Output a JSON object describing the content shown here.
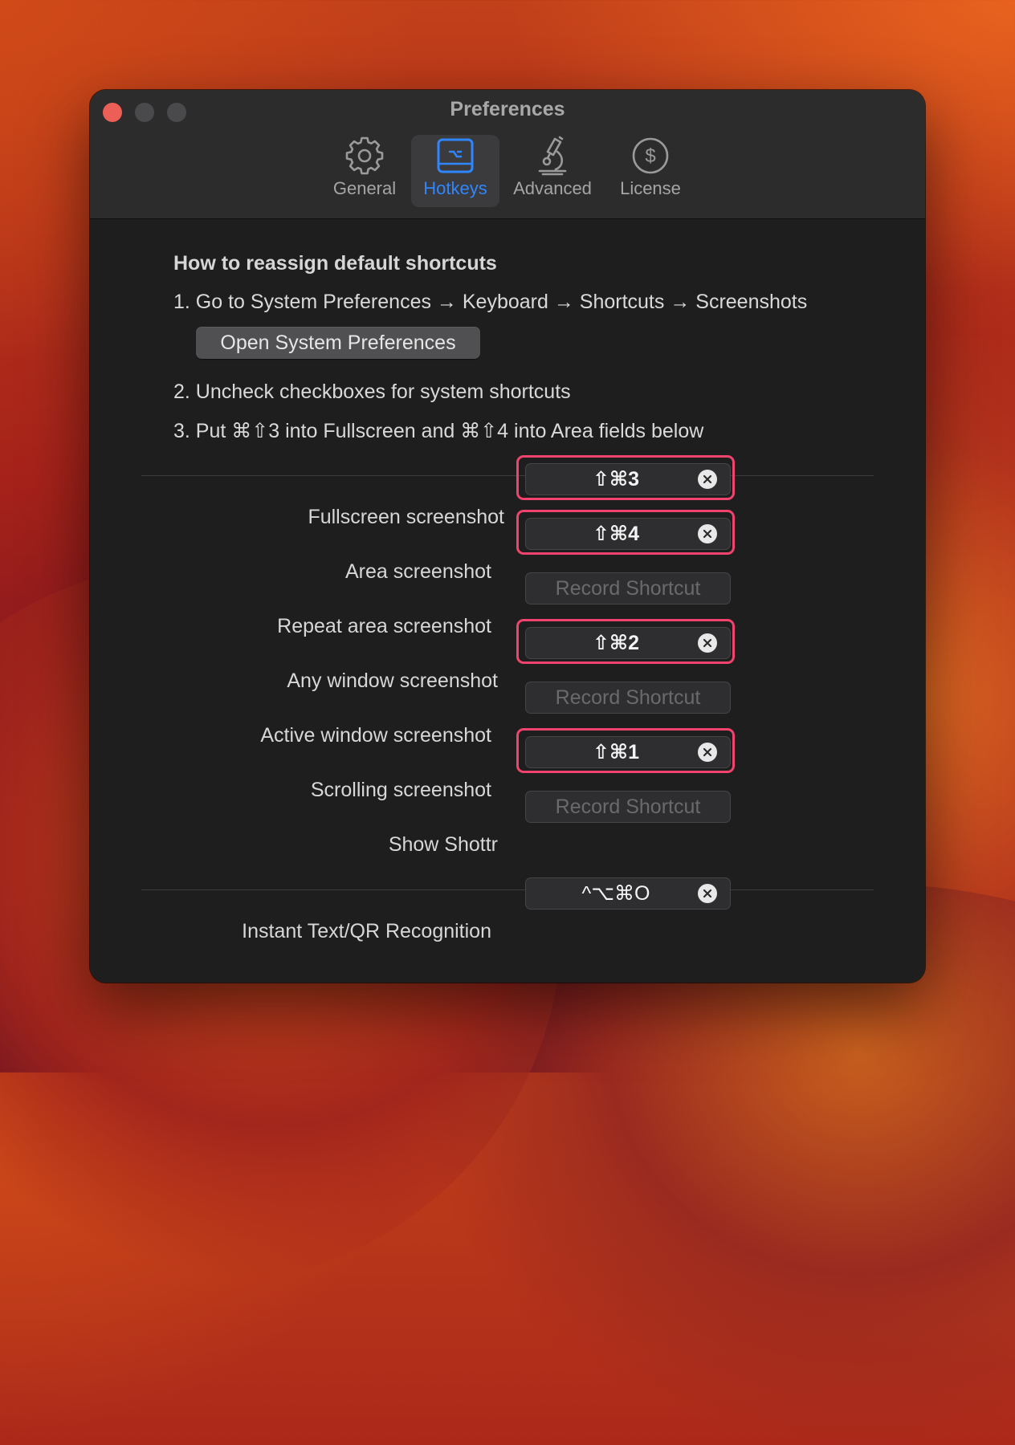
{
  "window": {
    "title": "Preferences"
  },
  "tabs": [
    {
      "label": "General",
      "icon": "gear-icon"
    },
    {
      "label": "Hotkeys",
      "icon": "keyboard-icon",
      "active": true
    },
    {
      "label": "Advanced",
      "icon": "microscope-icon"
    },
    {
      "label": "License",
      "icon": "dollar-icon"
    }
  ],
  "instructions": {
    "heading": "How to reassign default shortcuts",
    "step1": "1. Go to System Preferences → Keyboard → Shortcuts → Screenshots",
    "open_button": "Open System Preferences",
    "step2": "2. Uncheck checkboxes for system shortcuts",
    "step3": "3. Put ⌘⇧3 into Fullscreen and ⌘⇧4 into Area fields below"
  },
  "shortcuts": [
    {
      "label": "Fullscreen screenshot",
      "value": "⇧⌘3",
      "highlighted": true
    },
    {
      "label": "Area screenshot",
      "value": "⇧⌘4",
      "highlighted": true
    },
    {
      "label": "Repeat area screenshot",
      "value": null,
      "placeholder": "Record Shortcut"
    },
    {
      "label": "Any window screenshot",
      "value": "⇧⌘2",
      "highlighted": true
    },
    {
      "label": "Active window screenshot",
      "value": null,
      "placeholder": "Record Shortcut"
    },
    {
      "label": "Scrolling screenshot",
      "value": "⇧⌘1",
      "highlighted": true
    },
    {
      "label": "Show Shottr",
      "value": null,
      "placeholder": "Record Shortcut"
    }
  ],
  "ocr": {
    "label": "Instant Text/QR Recognition",
    "value": "^⌥⌘O"
  },
  "colors": {
    "accent": "#2f86ff",
    "highlight": "#f0436d",
    "close": "#ec5f57"
  }
}
